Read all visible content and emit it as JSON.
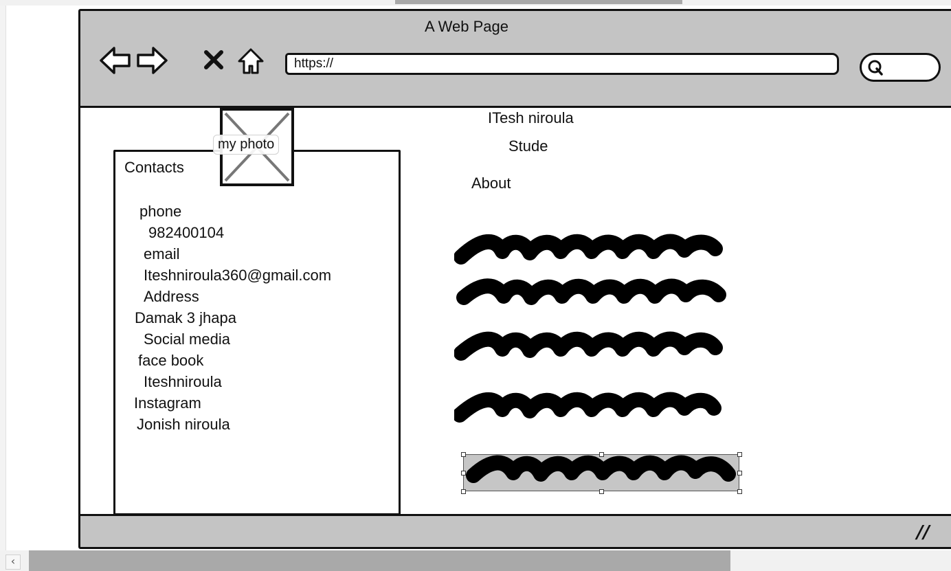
{
  "browser": {
    "title": "A Web Page",
    "url": "https://",
    "nav_icons": [
      "back-arrow-icon",
      "forward-arrow-icon",
      "stop-icon",
      "home-icon"
    ],
    "search_icon": "search-icon",
    "resize_grip": "//"
  },
  "photo": {
    "label": "my photo"
  },
  "contacts": {
    "title": "Contacts",
    "lines": [
      "phone",
      "982400104",
      "email",
      "Iteshniroula360@gmail.com",
      "Address",
      "Damak 3 jhapa",
      "Social media",
      "face book",
      "Iteshniroula",
      "Instagram",
      "Jonish niroula"
    ]
  },
  "main": {
    "name": "ITesh niroula",
    "role": "Stude",
    "about": "About"
  },
  "colors": {
    "chrome": "#c4c4c4",
    "ink": "#111111",
    "scroll_thumb": "#a9a9a9"
  }
}
